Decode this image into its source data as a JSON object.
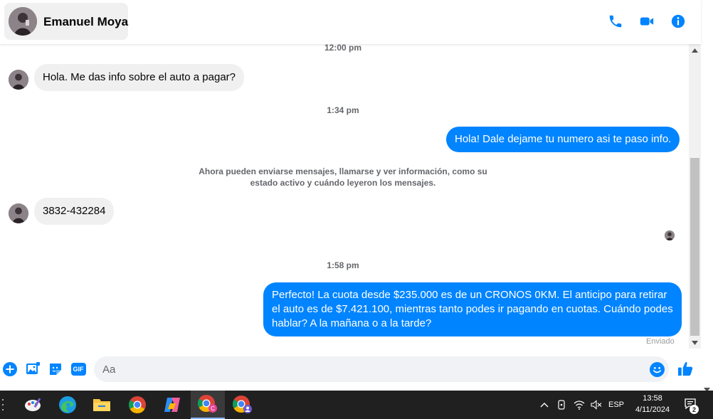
{
  "header": {
    "contact_name": "Emanuel Moya",
    "icons": [
      "phone-icon",
      "video-camera-icon",
      "info-icon"
    ]
  },
  "conversation": {
    "timestamps": [
      "12:00 pm",
      "1:34 pm",
      "1:58 pm"
    ],
    "messages": [
      {
        "direction": "incoming",
        "text": "Hola. Me das info sobre el auto a pagar?"
      },
      {
        "direction": "outgoing",
        "text": "Hola! Dale dejame tu numero  asi te paso info."
      },
      {
        "direction": "incoming",
        "text": "3832-432284"
      },
      {
        "direction": "outgoing",
        "text": "Perfecto! La cuota desde $235.000 es de un CRONOS 0KM. El anticipo para retirar el auto es de $7.421.100, mientras tanto podes ir pagando en cuotas. Cuándo podes hablar? A la mañana o a la tarde?"
      }
    ],
    "system_note": "Ahora pueden enviarse mensajes, llamarse y ver información, como su estado activo y cuándo leyeron los mensajes.",
    "status": "Enviado"
  },
  "composer": {
    "placeholder": "Aa",
    "gif_label": "GIF",
    "icons": [
      "add-icon",
      "photo-icon",
      "sticker-icon",
      "gif-icon",
      "emoji-icon",
      "like-icon"
    ]
  },
  "taskbar": {
    "apps": [
      "paint-icon",
      "edge-icon",
      "file-explorer-icon",
      "chrome-icon",
      "copilot-icon",
      "chrome-profile-icon",
      "chrome-profile-icon"
    ],
    "language": "ESP",
    "time": "13:58",
    "date": "4/11/2024",
    "notification_count": "2"
  },
  "colors": {
    "brand_blue": "#0084ff",
    "incoming_bubble": "#f0f0f0",
    "taskbar": "#202020"
  }
}
